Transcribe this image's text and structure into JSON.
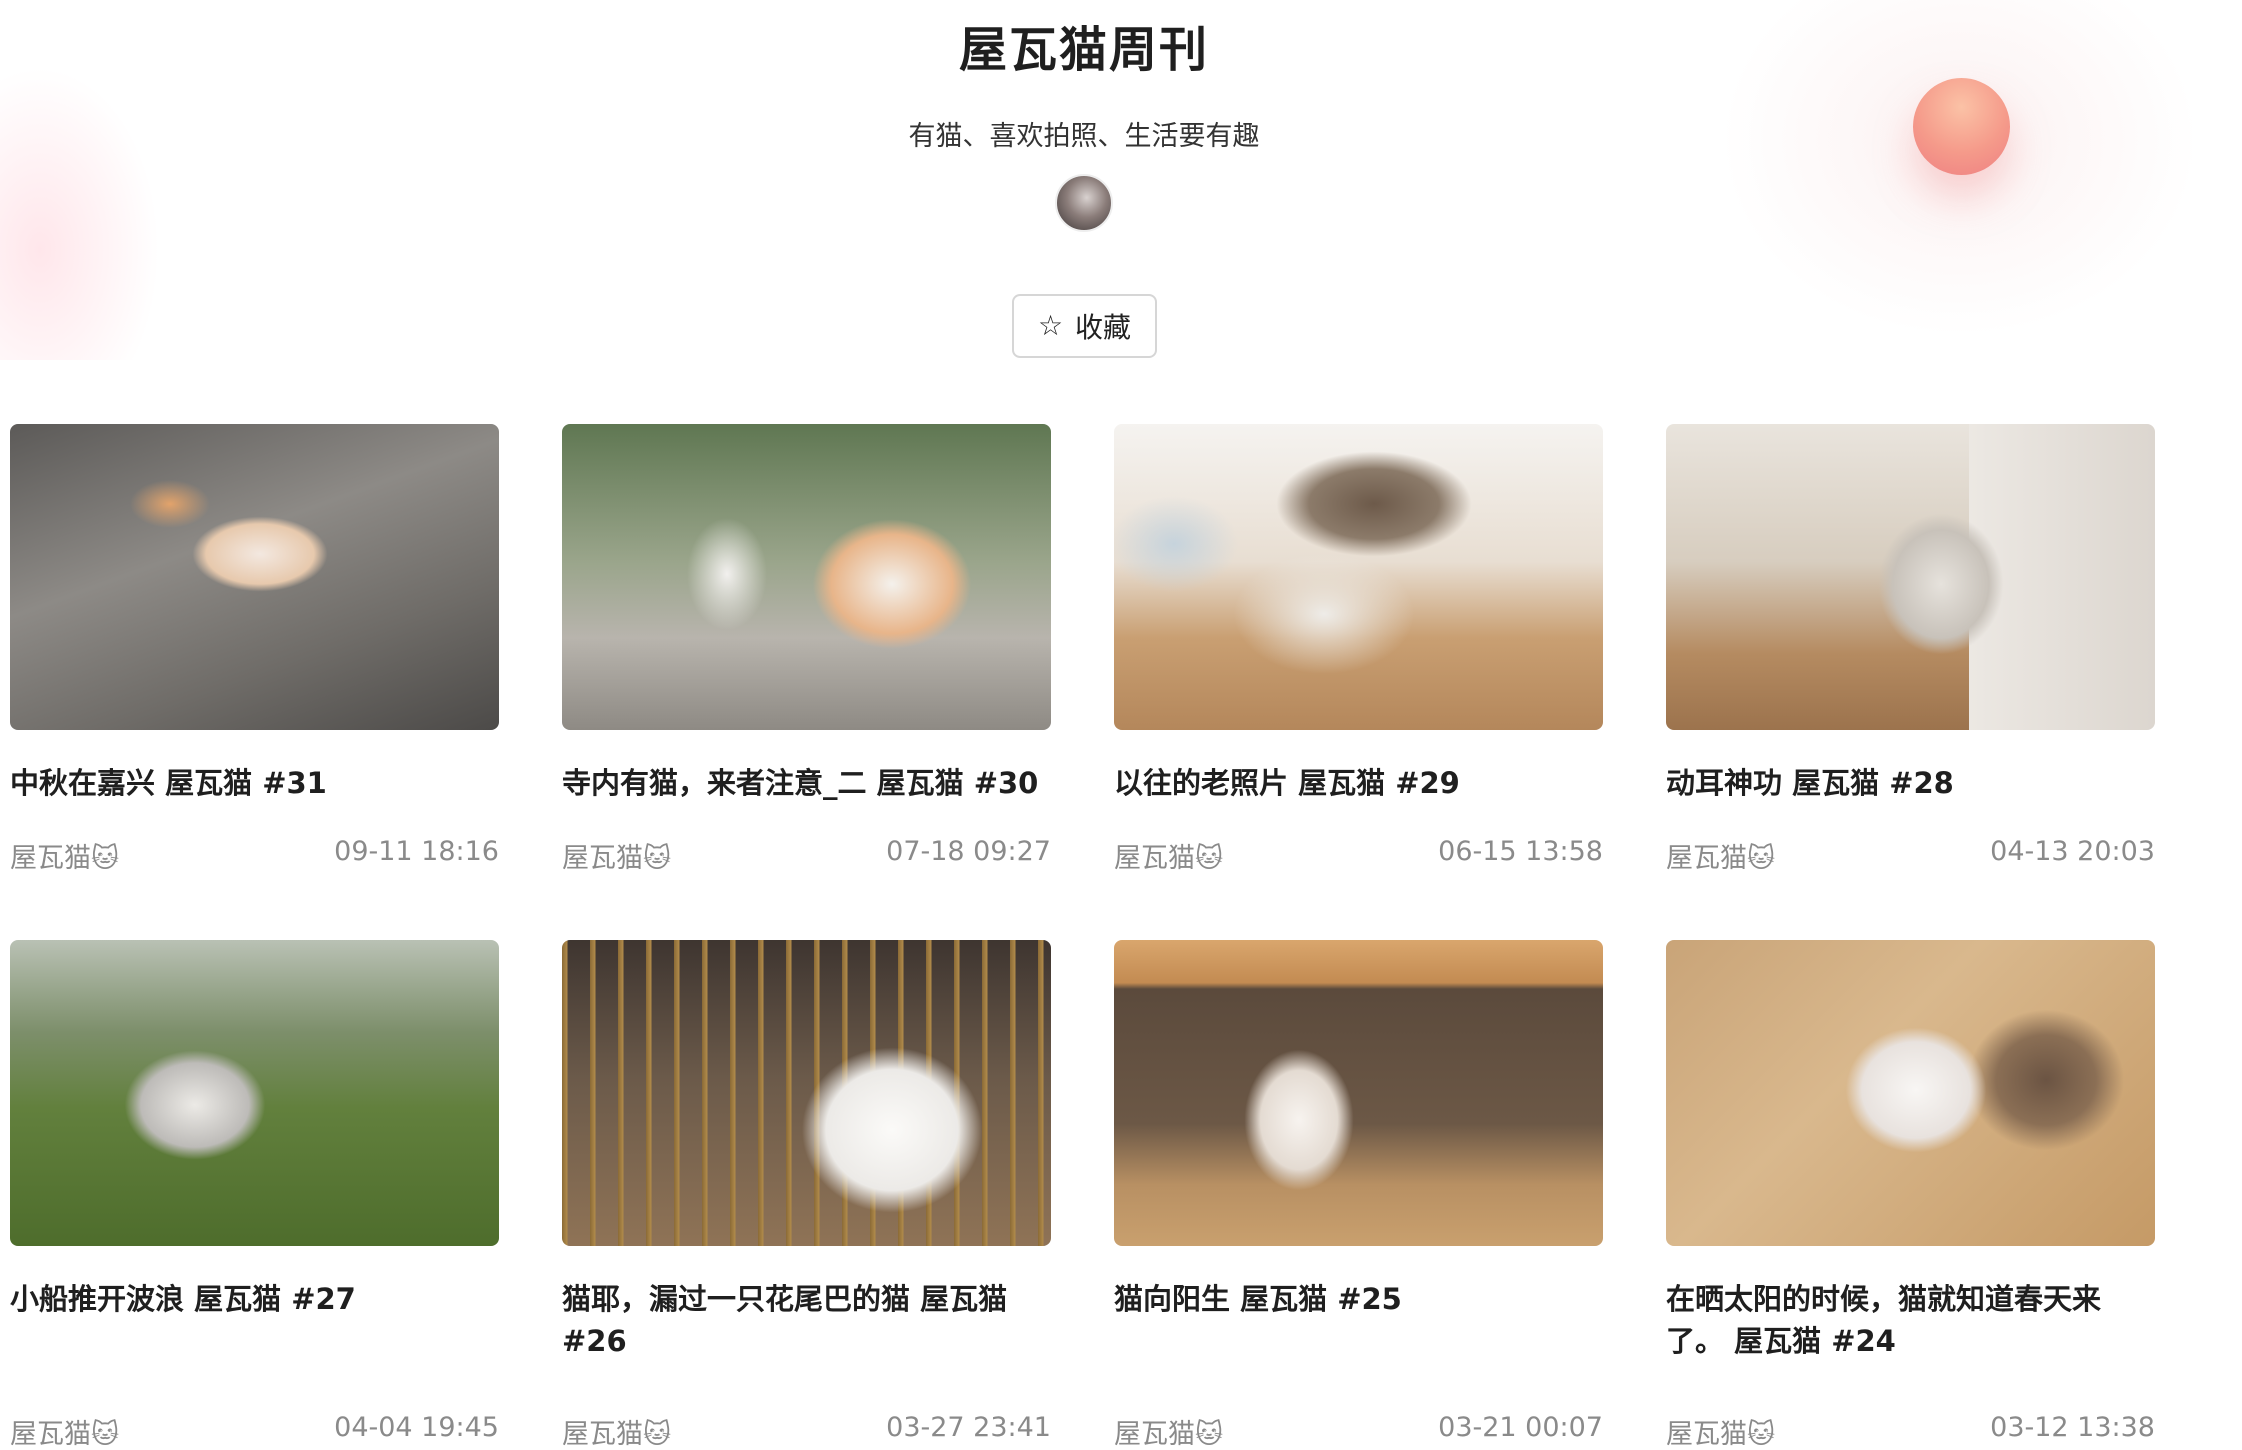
{
  "header": {
    "title": "屋瓦猫周刊",
    "subtitle": "有猫、喜欢拍照、生活要有趣",
    "favorite_label": "收藏",
    "favorite_icon": "star-outline-icon"
  },
  "posts": [
    {
      "title": "中秋在嘉兴 屋瓦猫 #31",
      "author": "屋瓦猫🐱",
      "date": "09-11 18:16"
    },
    {
      "title": "寺内有猫，来者注意_二 屋瓦猫 #30",
      "author": "屋瓦猫🐱",
      "date": "07-18 09:27"
    },
    {
      "title": "以往的老照片 屋瓦猫 #29",
      "author": "屋瓦猫🐱",
      "date": "06-15 13:58"
    },
    {
      "title": "动耳神功 屋瓦猫 #28",
      "author": "屋瓦猫🐱",
      "date": "04-13 20:03"
    },
    {
      "title": "小船推开波浪 屋瓦猫 #27",
      "author": "屋瓦猫🐱",
      "date": "04-04 19:45"
    },
    {
      "title": "猫耶，漏过一只花尾巴的猫 屋瓦猫 #26",
      "author": "屋瓦猫🐱",
      "date": "03-27 23:41"
    },
    {
      "title": "猫向阳生 屋瓦猫 #25",
      "author": "屋瓦猫🐱",
      "date": "03-21 00:07"
    },
    {
      "title": "在晒太阳的时候，猫就知道春天来了。 屋瓦猫 #24",
      "author": "屋瓦猫🐱",
      "date": "03-12 13:38"
    }
  ]
}
